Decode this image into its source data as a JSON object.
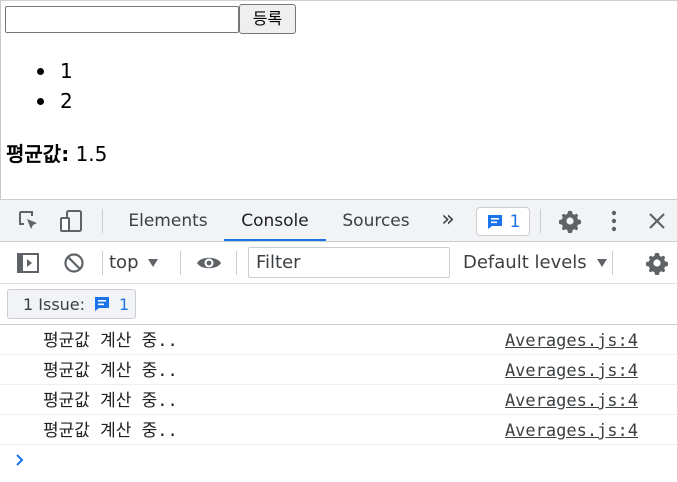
{
  "page": {
    "input_value": "",
    "register_button": "등록",
    "list_items": [
      "1",
      "2"
    ],
    "average_label": "평균값:",
    "average_value": "1.5"
  },
  "devtools": {
    "tabs": [
      {
        "label": "Elements",
        "active": false
      },
      {
        "label": "Console",
        "active": true
      },
      {
        "label": "Sources",
        "active": false
      }
    ],
    "more_tabs": "»",
    "message_count": "1",
    "context": "top",
    "filter_placeholder": "Filter",
    "levels_label": "Default levels",
    "issues_label": "1 Issue:",
    "issues_count": "1",
    "logs": [
      {
        "message": "평균값 계산 중..",
        "source": "Averages.js:4"
      },
      {
        "message": "평균값 계산 중..",
        "source": "Averages.js:4"
      },
      {
        "message": "평균값 계산 중..",
        "source": "Averages.js:4"
      },
      {
        "message": "평균값 계산 중..",
        "source": "Averages.js:4"
      }
    ],
    "icons": {
      "inspect": "inspect-element-icon",
      "device": "device-toolbar-icon",
      "settings": "gear-icon",
      "more": "kebab-menu-icon",
      "close": "close-icon",
      "sidebar": "sidebar-toggle-icon",
      "clear": "clear-console-icon",
      "eye": "live-expression-icon",
      "message": "message-icon",
      "prompt": "chevron-right-icon"
    },
    "colors": {
      "accent": "#1a73e8",
      "toolbar_bg": "#f1f3f4",
      "icon": "#5f6368"
    }
  }
}
